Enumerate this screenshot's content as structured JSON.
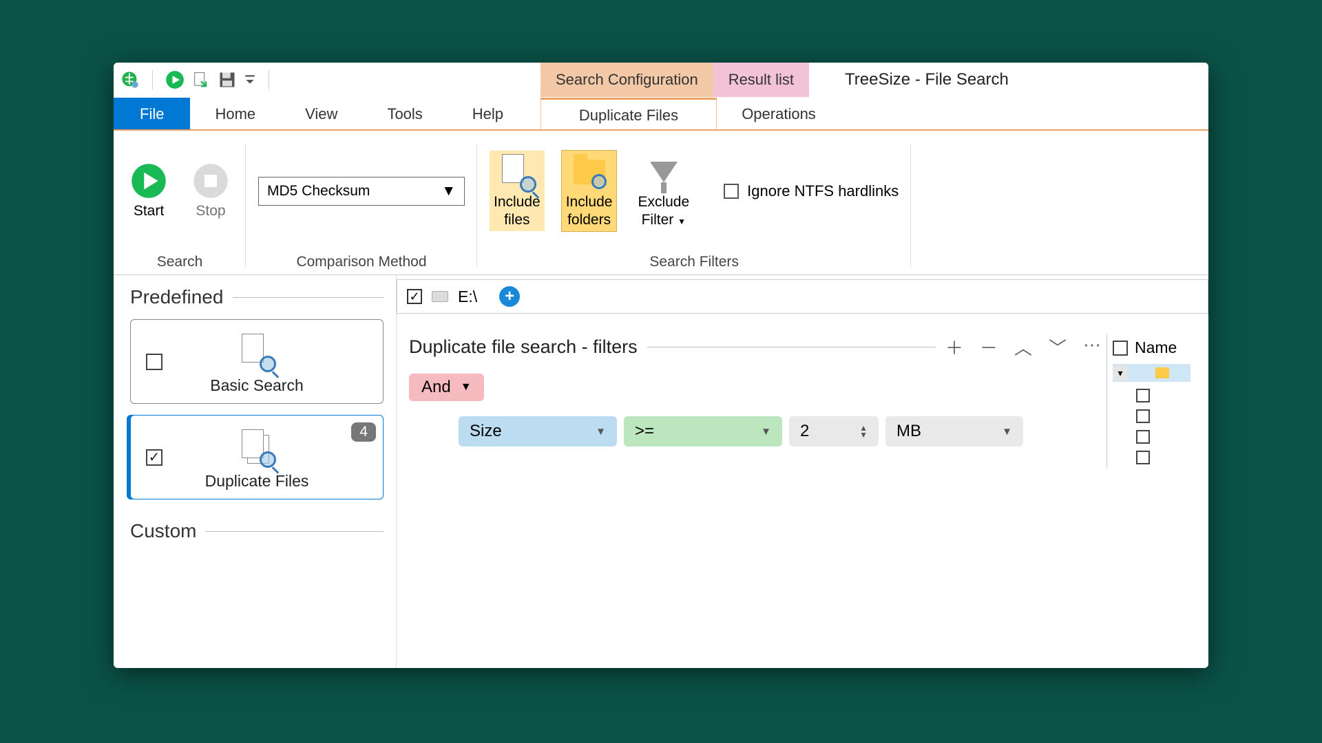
{
  "app_title": "TreeSize - File Search",
  "context_tabs": {
    "config": "Search Configuration",
    "result": "Result list"
  },
  "tabs": {
    "file": "File",
    "home": "Home",
    "view": "View",
    "tools": "Tools",
    "help": "Help",
    "duplicate": "Duplicate Files",
    "operations": "Operations"
  },
  "ribbon": {
    "search": {
      "start": "Start",
      "stop": "Stop",
      "group": "Search"
    },
    "comparison": {
      "value": "MD5 Checksum",
      "group": "Comparison Method"
    },
    "filters": {
      "include_files": "Include\nfiles",
      "include_folders": "Include\nfolders",
      "exclude_filter": "Exclude\nFilter",
      "ignore_hardlinks": "Ignore NTFS hardlinks",
      "group": "Search Filters"
    }
  },
  "left": {
    "predefined": "Predefined",
    "basic": "Basic Search",
    "duplicate": "Duplicate Files",
    "dup_badge": "4",
    "custom": "Custom"
  },
  "path": {
    "drive": "E:\\"
  },
  "filters": {
    "title": "Duplicate file search - filters",
    "logic": "And",
    "row": {
      "field": "Size",
      "op": ">=",
      "val": "2",
      "unit": "MB"
    }
  },
  "right": {
    "name": "Name"
  }
}
